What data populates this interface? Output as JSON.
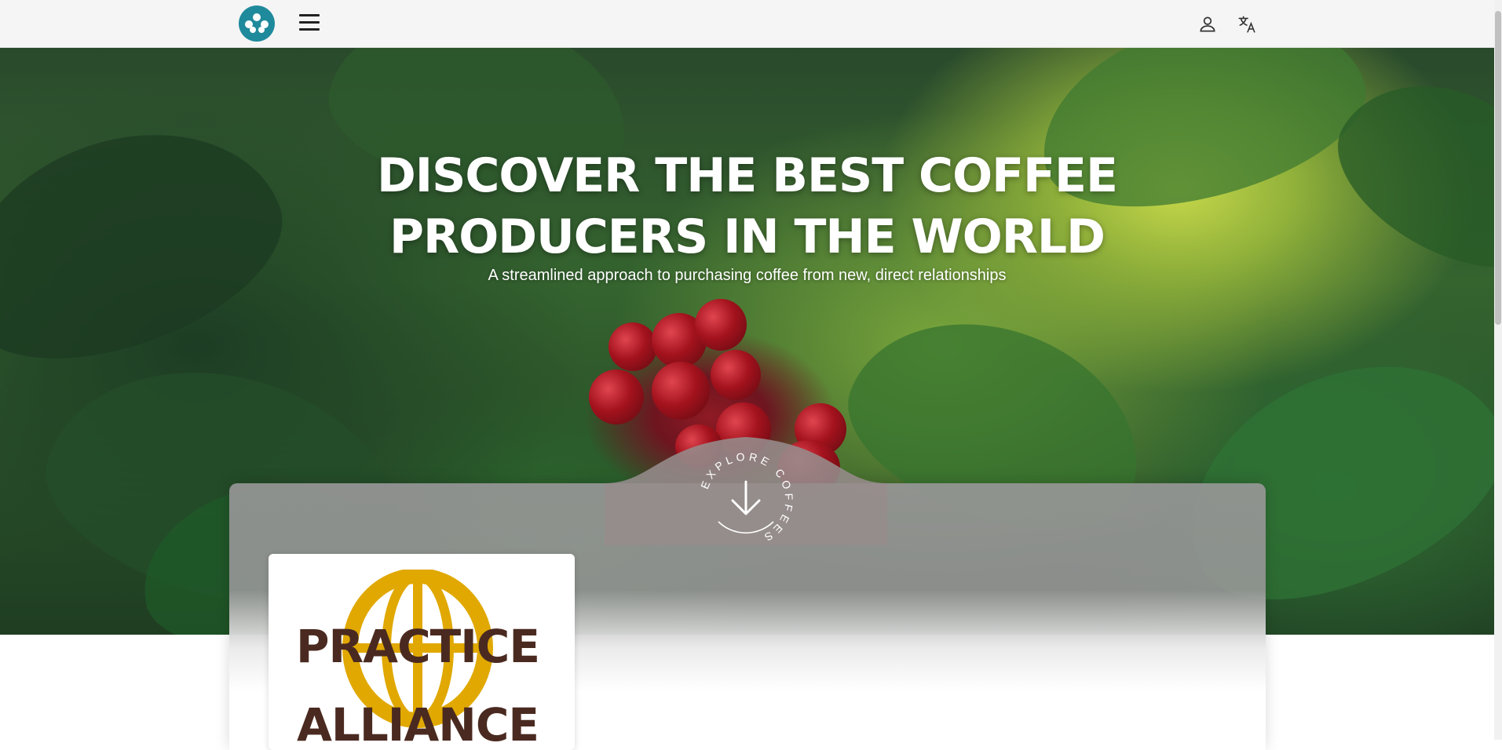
{
  "nav": {
    "logo_icon": "brand-logo-icon",
    "menu_icon": "hamburger-menu-icon",
    "account_icon": "user-icon",
    "language_icon": "translate-icon"
  },
  "hero": {
    "title_line1": "DISCOVER THE BEST COFFEE",
    "title_line2": "PRODUCERS IN THE WORLD",
    "subtitle": "A streamlined approach to purchasing coffee from new, direct relationships",
    "explore_label": "EXPLORE COFFEES",
    "explore_icon": "arrow-down-icon"
  },
  "producers": [
    {
      "logo_text_line1": "PRACTICE",
      "logo_text_line2": "ALLIANCE"
    }
  ],
  "colors": {
    "brand": "#1f8a9c",
    "logo_gold": "#e0a800",
    "logo_brown": "#4a2a20"
  }
}
